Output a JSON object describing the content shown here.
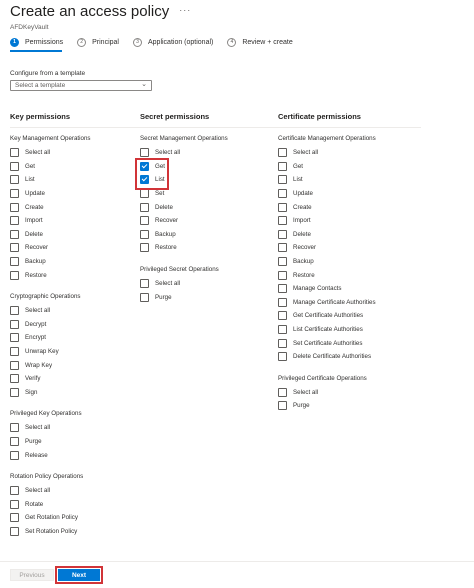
{
  "header": {
    "title": "Create an access policy",
    "more": "···",
    "subtitle": "AFDKeyVault"
  },
  "steps": [
    {
      "num": "1",
      "label": "Permissions",
      "active": true
    },
    {
      "num": "2",
      "label": "Principal",
      "active": false
    },
    {
      "num": "3",
      "label": "Application (optional)",
      "active": false
    },
    {
      "num": "4",
      "label": "Review + create",
      "active": false
    }
  ],
  "template": {
    "label": "Configure from a template",
    "placeholder": "Select a template"
  },
  "key_permissions": {
    "title": "Key permissions",
    "groups": [
      {
        "title": "Key Management Operations",
        "items": [
          {
            "label": "Select all",
            "checked": false
          },
          {
            "label": "Get",
            "checked": false
          },
          {
            "label": "List",
            "checked": false
          },
          {
            "label": "Update",
            "checked": false
          },
          {
            "label": "Create",
            "checked": false
          },
          {
            "label": "Import",
            "checked": false
          },
          {
            "label": "Delete",
            "checked": false
          },
          {
            "label": "Recover",
            "checked": false
          },
          {
            "label": "Backup",
            "checked": false
          },
          {
            "label": "Restore",
            "checked": false
          }
        ]
      },
      {
        "title": "Cryptographic Operations",
        "items": [
          {
            "label": "Select all",
            "checked": false
          },
          {
            "label": "Decrypt",
            "checked": false
          },
          {
            "label": "Encrypt",
            "checked": false
          },
          {
            "label": "Unwrap Key",
            "checked": false
          },
          {
            "label": "Wrap Key",
            "checked": false
          },
          {
            "label": "Verify",
            "checked": false
          },
          {
            "label": "Sign",
            "checked": false
          }
        ]
      },
      {
        "title": "Privileged Key Operations",
        "items": [
          {
            "label": "Select all",
            "checked": false
          },
          {
            "label": "Purge",
            "checked": false
          },
          {
            "label": "Release",
            "checked": false
          }
        ]
      },
      {
        "title": "Rotation Policy Operations",
        "items": [
          {
            "label": "Select all",
            "checked": false
          },
          {
            "label": "Rotate",
            "checked": false
          },
          {
            "label": "Get Rotation Policy",
            "checked": false
          },
          {
            "label": "Set Rotation Policy",
            "checked": false
          }
        ]
      }
    ]
  },
  "secret_permissions": {
    "title": "Secret permissions",
    "groups": [
      {
        "title": "Secret Management Operations",
        "items": [
          {
            "label": "Select all",
            "checked": false
          },
          {
            "label": "Get",
            "checked": true
          },
          {
            "label": "List",
            "checked": true
          },
          {
            "label": "Set",
            "checked": false
          },
          {
            "label": "Delete",
            "checked": false
          },
          {
            "label": "Recover",
            "checked": false
          },
          {
            "label": "Backup",
            "checked": false
          },
          {
            "label": "Restore",
            "checked": false
          }
        ]
      },
      {
        "title": "Privileged Secret Operations",
        "items": [
          {
            "label": "Select all",
            "checked": false
          },
          {
            "label": "Purge",
            "checked": false
          }
        ]
      }
    ]
  },
  "certificate_permissions": {
    "title": "Certificate permissions",
    "groups": [
      {
        "title": "Certificate Management Operations",
        "items": [
          {
            "label": "Select all",
            "checked": false
          },
          {
            "label": "Get",
            "checked": false
          },
          {
            "label": "List",
            "checked": false
          },
          {
            "label": "Update",
            "checked": false
          },
          {
            "label": "Create",
            "checked": false
          },
          {
            "label": "Import",
            "checked": false
          },
          {
            "label": "Delete",
            "checked": false
          },
          {
            "label": "Recover",
            "checked": false
          },
          {
            "label": "Backup",
            "checked": false
          },
          {
            "label": "Restore",
            "checked": false
          },
          {
            "label": "Manage Contacts",
            "checked": false
          },
          {
            "label": "Manage Certificate Authorities",
            "checked": false
          },
          {
            "label": "Get Certificate Authorities",
            "checked": false
          },
          {
            "label": "List Certificate Authorities",
            "checked": false
          },
          {
            "label": "Set Certificate Authorities",
            "checked": false
          },
          {
            "label": "Delete Certificate Authorities",
            "checked": false
          }
        ]
      },
      {
        "title": "Privileged Certificate Operations",
        "items": [
          {
            "label": "Select all",
            "checked": false
          },
          {
            "label": "Purge",
            "checked": false
          }
        ]
      }
    ]
  },
  "footer": {
    "previous_label": "Previous",
    "next_label": "Next"
  },
  "colors": {
    "accent": "#0078d4",
    "highlight": "#d13438"
  }
}
